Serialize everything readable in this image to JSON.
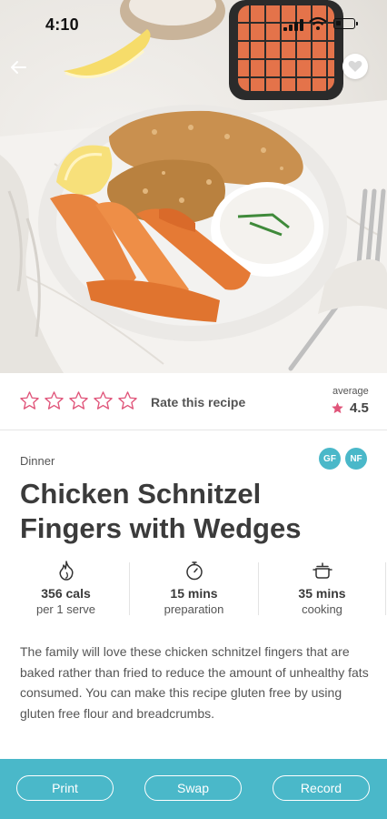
{
  "status_bar": {
    "time": "4:10"
  },
  "rating": {
    "star_count": 5,
    "rate_label": "Rate this recipe",
    "average_label": "average",
    "average_value": "4.5"
  },
  "recipe": {
    "category": "Dinner",
    "badges": [
      "GF",
      "NF"
    ],
    "title": "Chicken Schnitzel Fingers with Wedges",
    "stats": [
      {
        "icon": "flame-icon",
        "value": "356 cals",
        "label": "per 1 serve"
      },
      {
        "icon": "stopwatch-icon",
        "value": "15 mins",
        "label": "preparation"
      },
      {
        "icon": "cooking-pot-icon",
        "value": "35 mins",
        "label": "cooking"
      }
    ],
    "description": "The family will love these chicken schnitzel fingers that are baked rather than fried to reduce the amount of unhealthy fats consumed. You can make this recipe gluten free by using gluten free flour and breadcrumbs."
  },
  "actions": {
    "print": "Print",
    "swap": "Swap",
    "record": "Record"
  },
  "colors": {
    "accent": "#4ab8c9",
    "star_outline": "#e0557a",
    "star_fill": "#e0557a"
  }
}
